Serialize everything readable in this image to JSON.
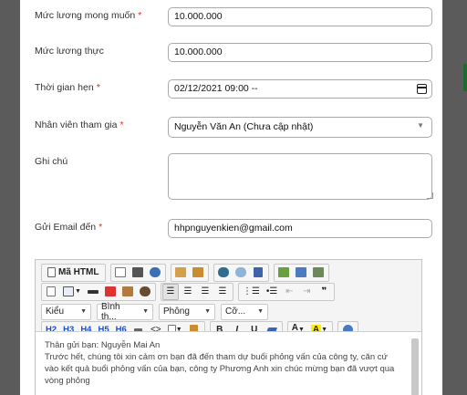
{
  "form": {
    "desired_salary": {
      "label": "Mức lương mong muốn",
      "value": "10.000.000",
      "required": "*"
    },
    "actual_salary": {
      "label": "Mức lương thực",
      "value": "10.000.000"
    },
    "appointment": {
      "label": "Thời gian hẹn",
      "value": "02/12/2021 09:00 --",
      "required": "*"
    },
    "staff": {
      "label": "Nhân viên tham gia",
      "value": "Nguyễn Văn An (Chưa cập nhật)",
      "required": "*"
    },
    "note": {
      "label": "Ghi chú",
      "value": ""
    },
    "send_email": {
      "label": "Gửi Email đến",
      "value": "hhpnguyenkien@gmail.com",
      "required": "*"
    }
  },
  "editor": {
    "source_label": "Mã HTML",
    "style_combo": "Kiểu",
    "format_combo": "Bình th...",
    "font_combo": "Phông",
    "size_combo": "Cỡ...",
    "headings": [
      "H2",
      "H3",
      "H4",
      "H5",
      "H6"
    ],
    "bold": "B",
    "italic": "I",
    "underline": "U",
    "blockquote": "❞",
    "content": [
      "Thân gửi bạn: Nguyễn Mai An",
      "Trước hết, chúng tôi xin cảm ơn bạn đã đến tham dự buổi phỏng vấn của công ty, căn cứ vào kết quả buổi phỏng vấn của bạn, công ty Phương Anh xin chúc mừng bạn đã vượt qua vòng phỏng"
    ]
  },
  "colors": {
    "required": "#d9302c",
    "accent": "#1f6b2f"
  }
}
